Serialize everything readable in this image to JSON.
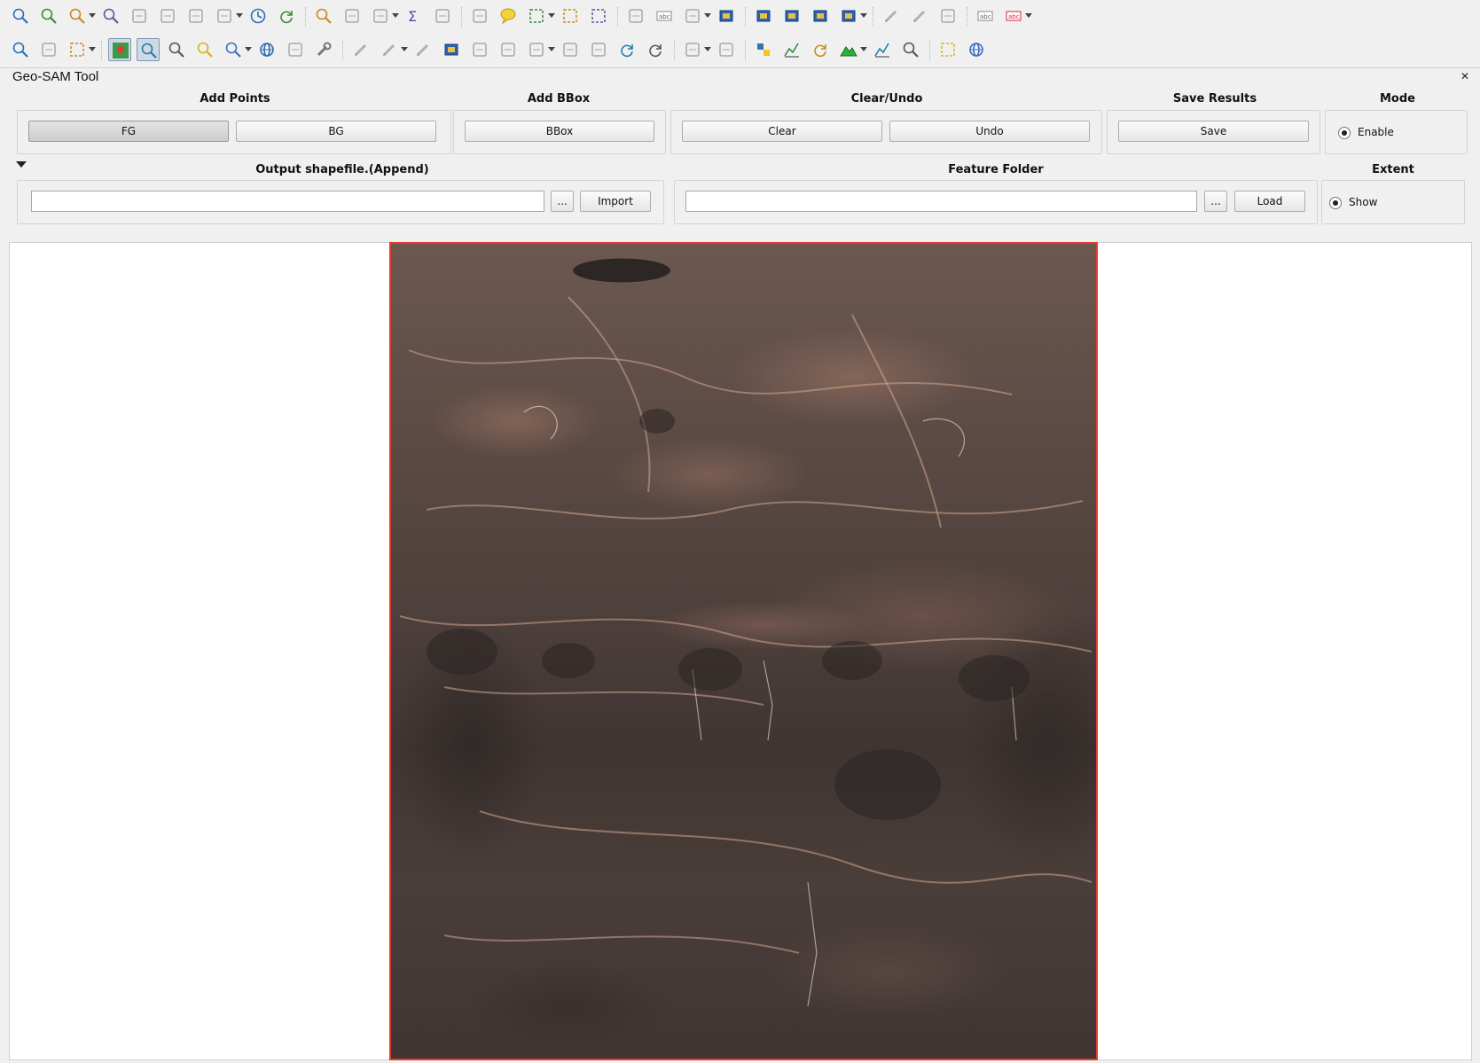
{
  "app": {
    "toolbar_row1_icons": [
      "pan-map-icon",
      "zoom-full-icon",
      "zoom-to-layer-icon",
      "zoom-last-icon",
      "new-map-view-icon",
      "new-3d-view-icon",
      "bookmark-new-icon",
      "show-bookmarks-icon",
      "temporal-controller-icon",
      "refresh-icon",
      "identify-icon",
      "attribute-table-icon",
      "statistics-icon",
      "sum-icon",
      "field-calc-icon",
      "measure-icon",
      "map-tips-icon",
      "select-icon",
      "deselect-icon",
      "select-location-icon",
      "style-manager-icon",
      "label-icon",
      "processing-icon",
      "add-wms-icon",
      "add-vector-icon",
      "add-raster-icon",
      "add-wfs-icon",
      "add-text-icon",
      "digitize-icon",
      "advanced-digitize-icon",
      "node-tool-icon",
      "label-toolbar-icon",
      "abc-label-icon"
    ],
    "toolbar_row2_icons": [
      "identify-features-icon",
      "run-feature-action-icon",
      "select-features-icon",
      "geosam-points-icon",
      "geosam-pan-icon",
      "zoom-in-icon",
      "zoom-out-icon",
      "zoom-selection-icon",
      "globe-icon",
      "coordinate-capture-icon",
      "settings-wrench-icon",
      "edit-pencil-icon",
      "toggle-edit-icon",
      "save-edits-icon",
      "add-polygon-icon",
      "vertex-tool-icon",
      "delete-icon",
      "cut-icon",
      "copy-icon",
      "paste-icon",
      "undo-icon",
      "redo-icon",
      "reshape-icon",
      "offset-icon",
      "python-icon",
      "profile-tool-icon",
      "refresh-layer-icon",
      "terrain-icon",
      "line-chart-icon",
      "info-magnifier-icon",
      "grid-select-icon",
      "target-icon"
    ],
    "accent_color": "#e23b2e"
  },
  "dock": {
    "title": "Geo-SAM Tool",
    "close_symbol": "✕"
  },
  "groups": {
    "add_points": {
      "label": "Add Points",
      "fg_button": "FG",
      "bg_button": "BG"
    },
    "add_bbox": {
      "label": "Add BBox",
      "bbox_button": "BBox"
    },
    "clear_undo": {
      "label": "Clear/Undo",
      "clear_button": "Clear",
      "undo_button": "Undo"
    },
    "save_results": {
      "label": "Save Results",
      "save_button": "Save"
    },
    "mode": {
      "label": "Mode",
      "enable_option": "Enable"
    },
    "output_shapefile": {
      "label": "Output shapefile.(Append)",
      "path_value": "",
      "browse_button": "...",
      "import_button": "Import"
    },
    "feature_folder": {
      "label": "Feature Folder",
      "path_value": "",
      "browse_button": "...",
      "load_button": "Load"
    },
    "extent": {
      "label": "Extent",
      "show_option": "Show"
    }
  }
}
